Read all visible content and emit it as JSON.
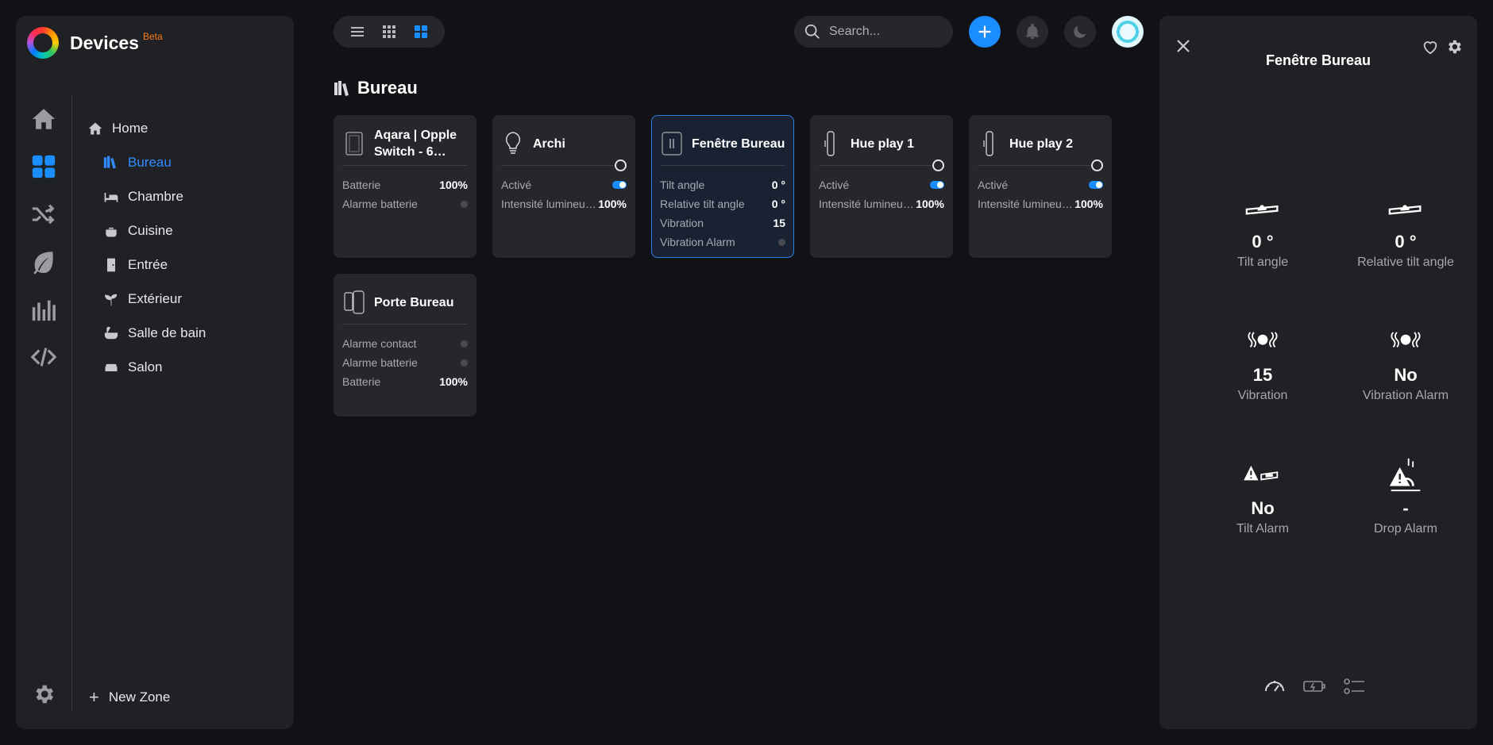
{
  "app": {
    "title": "Devices",
    "badge": "Beta"
  },
  "zones": [
    {
      "label": "Home",
      "type": "home",
      "icon": "home-icon"
    },
    {
      "label": "Bureau",
      "type": "sub",
      "icon": "books-icon",
      "active": true
    },
    {
      "label": "Chambre",
      "type": "sub",
      "icon": "bed-icon"
    },
    {
      "label": "Cuisine",
      "type": "sub",
      "icon": "pot-icon"
    },
    {
      "label": "Entrée",
      "type": "sub",
      "icon": "door-icon"
    },
    {
      "label": "Extérieur",
      "type": "sub",
      "icon": "sprout-icon"
    },
    {
      "label": "Salle de bain",
      "type": "sub",
      "icon": "bathtub-icon"
    },
    {
      "label": "Salon",
      "type": "sub",
      "icon": "sofa-icon"
    }
  ],
  "new_zone_label": "New Zone",
  "search": {
    "placeholder": "Search..."
  },
  "section": {
    "title": "Bureau"
  },
  "cards": [
    {
      "name": "Aqara | Opple Switch - 6…",
      "icon": "wall-switch-icon",
      "rows": [
        {
          "label": "Batterie",
          "value": "100%"
        },
        {
          "label": "Alarme batterie",
          "value": "",
          "kind": "dot"
        }
      ]
    },
    {
      "name": "Archi",
      "icon": "bulb-icon",
      "onoff": true,
      "rows": [
        {
          "label": "Activé",
          "value": "",
          "kind": "toggle"
        },
        {
          "label": "Intensité lumineu…",
          "value": "100%"
        }
      ]
    },
    {
      "name": "Fenêtre Bureau",
      "icon": "window-sensor-icon",
      "selected": true,
      "rows": [
        {
          "label": "Tilt angle",
          "value": "0 °"
        },
        {
          "label": "Relative tilt angle",
          "value": "0 °"
        },
        {
          "label": "Vibration",
          "value": "15"
        },
        {
          "label": "Vibration Alarm",
          "value": "",
          "kind": "dot"
        }
      ]
    },
    {
      "name": "Hue play 1",
      "icon": "light-bar-icon",
      "onoff": true,
      "rows": [
        {
          "label": "Activé",
          "value": "",
          "kind": "toggle"
        },
        {
          "label": "Intensité lumineu…",
          "value": "100%"
        }
      ]
    },
    {
      "name": "Hue play 2",
      "icon": "light-bar-icon",
      "onoff": true,
      "rows": [
        {
          "label": "Activé",
          "value": "",
          "kind": "toggle"
        },
        {
          "label": "Intensité lumineu…",
          "value": "100%"
        }
      ]
    },
    {
      "name": "Porte Bureau",
      "icon": "contact-sensor-icon",
      "rows": [
        {
          "label": "Alarme contact",
          "value": "",
          "kind": "dot"
        },
        {
          "label": "Alarme batterie",
          "value": "",
          "kind": "dot"
        },
        {
          "label": "Batterie",
          "value": "100%"
        }
      ]
    }
  ],
  "panel": {
    "title": "Fenêtre Bureau",
    "metrics": [
      {
        "value": "0 °",
        "label": "Tilt angle",
        "icon": "tilt-icon"
      },
      {
        "value": "0 °",
        "label": "Relative tilt angle",
        "icon": "tilt-icon"
      },
      {
        "value": "15",
        "label": "Vibration",
        "icon": "vibration-icon"
      },
      {
        "value": "No",
        "label": "Vibration Alarm",
        "icon": "vibration-icon"
      },
      {
        "value": "No",
        "label": "Tilt Alarm",
        "icon": "tilt-alarm-icon"
      },
      {
        "value": "-",
        "label": "Drop Alarm",
        "icon": "drop-alarm-icon"
      }
    ]
  },
  "colors": {
    "accent": "#1a8dff",
    "active_zone": "#2f8bff",
    "beta": "#ff7a1a",
    "selected_border": "#2c7fe0"
  }
}
